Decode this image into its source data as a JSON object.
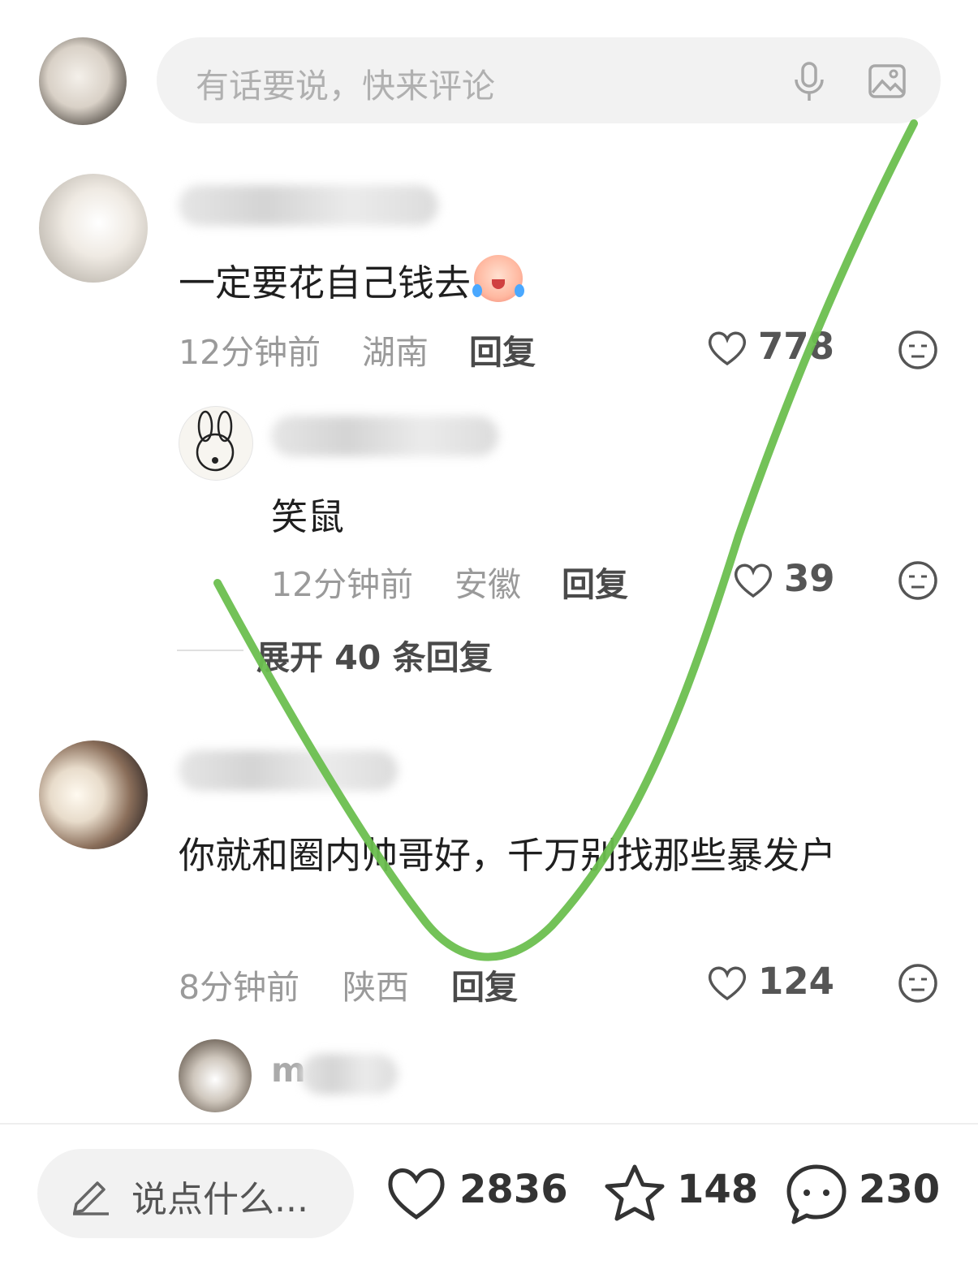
{
  "comment_input": {
    "placeholder": "有话要说，快来评论"
  },
  "comments": [
    {
      "author": "",
      "text": "一定要花自己钱去",
      "time": "12分钟前",
      "region": "湖南",
      "reply_label": "回复",
      "likes": "778",
      "replies": [
        {
          "author": "",
          "text": "笑鼠",
          "time": "12分钟前",
          "region": "安徽",
          "reply_label": "回复",
          "likes": "39"
        }
      ],
      "expand_label": "展开 40 条回复"
    },
    {
      "author": "",
      "text": "你就和圈内帅哥好，千万别找那些暴发户",
      "time": "8分钟前",
      "region": "陕西",
      "reply_label": "回复",
      "likes": "124",
      "replies": [
        {
          "author": "m"
        }
      ]
    }
  ],
  "bottom_bar": {
    "say_label": "说点什么...",
    "like_count": "2836",
    "star_count": "148",
    "comment_count": "230"
  },
  "colors": {
    "annotation_stroke": "#6cbf4f",
    "placeholder": "#b0b0b0"
  }
}
